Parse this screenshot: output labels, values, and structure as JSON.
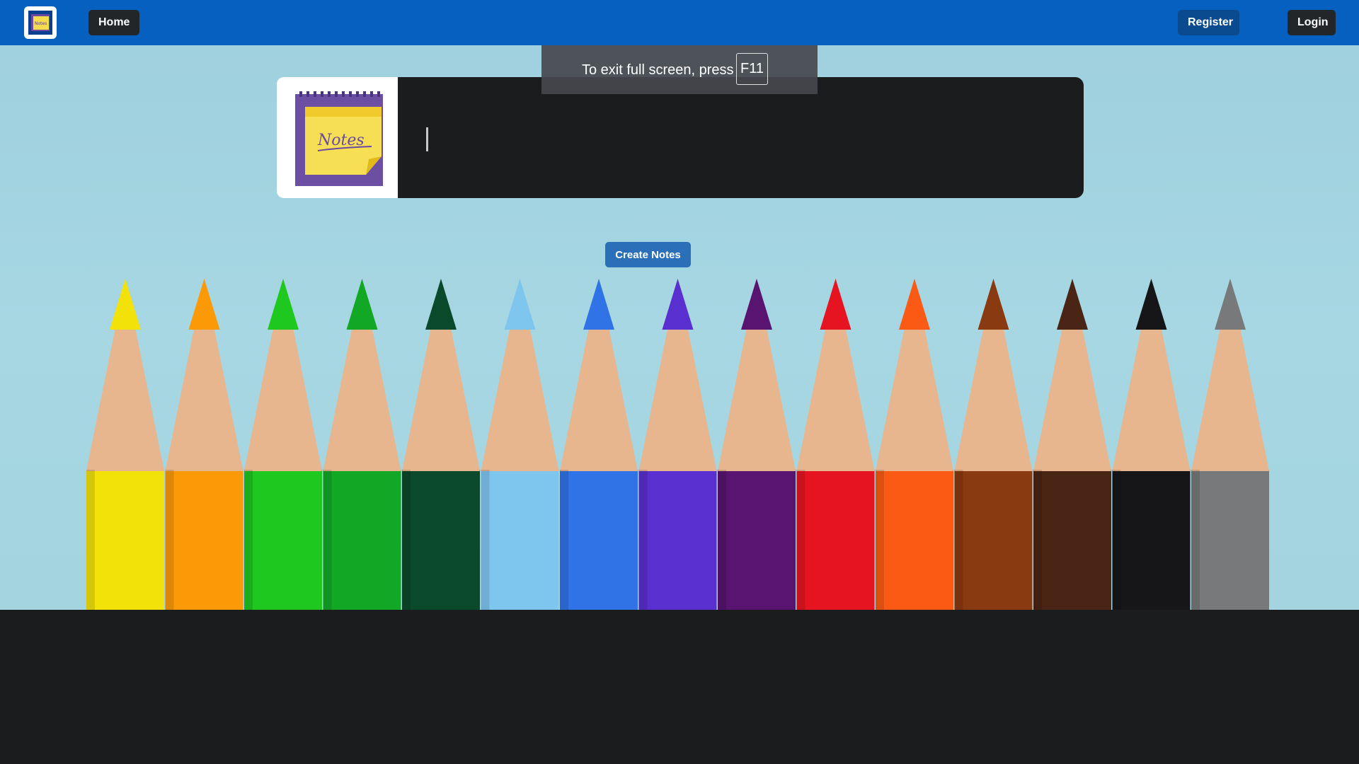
{
  "navbar": {
    "logo_icon": "notes-logo-icon",
    "home_label": "Home",
    "register_label": "Register",
    "login_label": "Login",
    "bg_color": "#0560bf"
  },
  "note_card": {
    "image_icon": "notes-pad-icon",
    "image_text": "Notes",
    "input_value": ""
  },
  "create_button": {
    "label": "Create Notes"
  },
  "fullscreen_notice": {
    "text": "To exit full screen, press",
    "key": "F11"
  },
  "pencils": {
    "colors": [
      "#f2e20a",
      "#fb9a06",
      "#1ec81e",
      "#12a826",
      "#0a4a2b",
      "#7fc6ef",
      "#2f73e6",
      "#5a2fcf",
      "#581470",
      "#e61420",
      "#fa5a14",
      "#8a3a10",
      "#4a2414",
      "#161618",
      "#77797a"
    ]
  }
}
